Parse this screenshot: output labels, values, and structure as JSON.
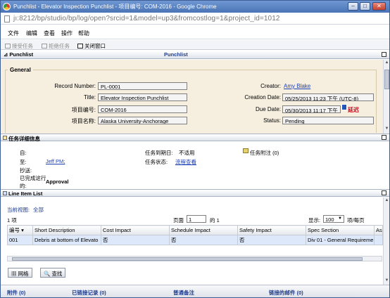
{
  "window": {
    "title": "Punchlist - Elevator Inspection Punchlist - 项目编号: COM-2016 - Google Chrome",
    "minimize": "–",
    "maximize": "□",
    "close": "✕"
  },
  "address": {
    "url": "jı:8212/bp/studio/bp/log/open?srcid=1&model=up3&fromcostlog=1&project_id=1012"
  },
  "menu": [
    "文件",
    "编辑",
    "查看",
    "操作",
    "帮助"
  ],
  "toolbar": {
    "accept": "接受任务",
    "reject": "拒绝任务",
    "close_window": "关闭窗口"
  },
  "tab": {
    "label": "Punchlist",
    "center_title": "Punchlist"
  },
  "general": {
    "legend": "General",
    "fields": {
      "record_number_label": "Record Number:",
      "record_number": "PL-0001",
      "title_label": "Title:",
      "title": "Elevator Inspection Punchlist",
      "project_no_label": "项目编号:",
      "project_no": "COM-2016",
      "project_name_label": "项目名称:",
      "project_name": "Alaska University-Anchorage",
      "creator_label": "Creator:",
      "creator": "Amy Blake",
      "creation_date_label": "Creation Date:",
      "creation_date": "05/25/2013 11:23 下午 (UTC-8)",
      "due_date_label": "Due Date:",
      "due_date": "05/30/2013 11:17 下午",
      "overdue": "延迟",
      "status_label": "Status:",
      "status": "Pending"
    }
  },
  "task_details": {
    "header": "任务详细信息",
    "from_label": "自:",
    "to_label": "至:",
    "to_value": "Jeff PM;",
    "cc_label": "抄送:",
    "completed_label": "已完成这行",
    "completed_label2": "的:",
    "completed_value": "Approval",
    "due_label": "任务到期日:",
    "due_value": "不适用",
    "status_label": "任务状态:",
    "status_link": "流程查看",
    "note": "任务附注 (0)"
  },
  "line_items": {
    "header": "Line Item List",
    "view_label": "当前视图:",
    "view_value": "全部",
    "count": "1 项",
    "page_label": "页面",
    "page_value": "1",
    "page_of": "的 1",
    "show_label": "显示:",
    "per_page_value": "100",
    "per_page_suffix": "项/每页",
    "columns": [
      "编号",
      "Short Description",
      "Cost Impact",
      "Schedule Impact",
      "Safety Impact",
      "Spec Section",
      "Ass"
    ],
    "rows": [
      [
        "001",
        "Debris at bottom of Elevato",
        "否",
        "否",
        "否",
        "Div 01 - General Requireme",
        ""
      ]
    ],
    "grid_button": "网格",
    "find_button": "查找"
  },
  "bottom": {
    "attachments": "附件 (0)",
    "linked_records": "已链接记录 (0)",
    "general_comments": "普通备注",
    "linked_mail": "链接的邮件 (0)"
  }
}
